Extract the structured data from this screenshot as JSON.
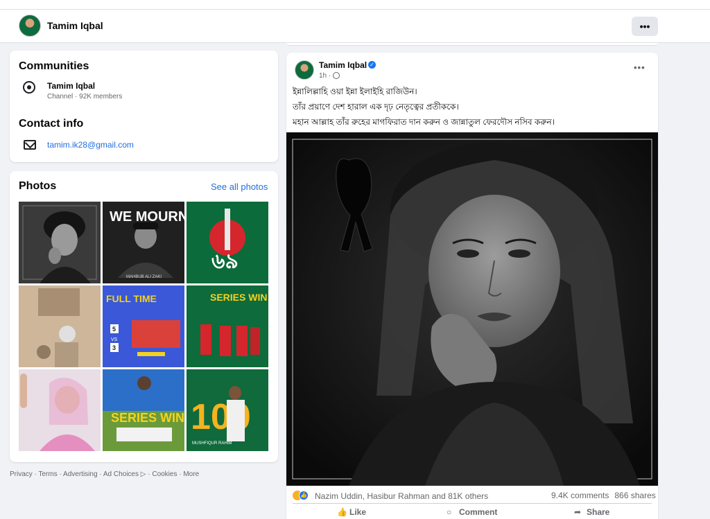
{
  "profile_bar": {
    "name": "Tamim Iqbal",
    "more_label": "•••"
  },
  "communities": {
    "title": "Communities",
    "item_name": "Tamim Iqbal",
    "item_meta": "Channel · 92K members"
  },
  "contact": {
    "title": "Contact info",
    "email": "tamim.ik28@gmail.com"
  },
  "photos": {
    "title": "Photos",
    "see_all": "See all photos",
    "tiles": [
      {
        "caption": ""
      },
      {
        "caption": "WE MOURN",
        "sub": "MAHBUB ALI ZAKI"
      },
      {
        "caption": "৬৯",
        "sub": ""
      },
      {
        "caption": ""
      },
      {
        "caption": "FULL TIME",
        "score_a": "5",
        "vs": "VS",
        "score_b": "3"
      },
      {
        "caption": "SERIES WIN"
      },
      {
        "caption": ""
      },
      {
        "caption": "SERIES WIN"
      },
      {
        "caption": "100",
        "sub": "MUSHFIQUR RAHIM"
      }
    ]
  },
  "footer": "Privacy · Terms · Advertising · Ad Choices ▷ · Cookies · More",
  "post": {
    "author": "Tamim Iqbal",
    "time": "1h ·",
    "more_label": "•••",
    "lines": [
      "ইন্নালিল্লাহি ওয়া ইন্না ইলাইহি রাজিউন।",
      "তাঁর প্রয়াণে দেশ হারাল এক দৃঢ় নেতৃত্বের প্রতীককে।",
      "মহান আল্লাহ তাঁর রুহের মাগফিরাত দান করুন ও জান্নাতুল ফেরদৌস নসিব করুন।"
    ],
    "reactions_text": "Nazim Uddin, Hasibur Rahman and 81K others",
    "comments": "9.4K comments",
    "shares": "866 shares",
    "actions": {
      "like": "Like",
      "comment": "Comment",
      "share": "Share"
    }
  },
  "icons": {
    "community": "channel-icon",
    "email": "mail-icon",
    "audience": "globe-icon",
    "like": "thumbs-up-icon",
    "comment": "speech-bubble-icon",
    "share": "share-arrow-icon"
  },
  "colors": {
    "link": "#216fdb",
    "page_bg": "#f0f2f5",
    "verified": "#1877f2"
  }
}
